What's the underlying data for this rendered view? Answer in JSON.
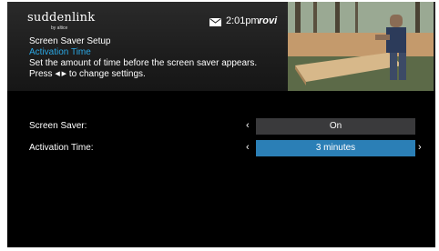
{
  "header": {
    "logo_main": "suddenlink",
    "logo_sub": "by altice",
    "mail_icon": "envelope-icon",
    "time": "2:01pm",
    "brand": "rovi"
  },
  "info": {
    "title": "Screen Saver Setup",
    "subtitle": "Activation Time",
    "description": "Set the amount of time before the screen saver appears.",
    "hint_prefix": "Press",
    "hint_arrows": "◀ ▶",
    "hint_suffix": "to change settings."
  },
  "settings": [
    {
      "label": "Screen Saver:",
      "value": "On",
      "selected": false
    },
    {
      "label": "Activation Time:",
      "value": "3 minutes",
      "selected": true
    }
  ],
  "arrows": {
    "left": "‹",
    "right": "›"
  },
  "colors": {
    "accent": "#2aa6e2",
    "selected_value_bg": "#2b7fb6",
    "value_bg": "#3a3a3c",
    "background": "#000000"
  }
}
